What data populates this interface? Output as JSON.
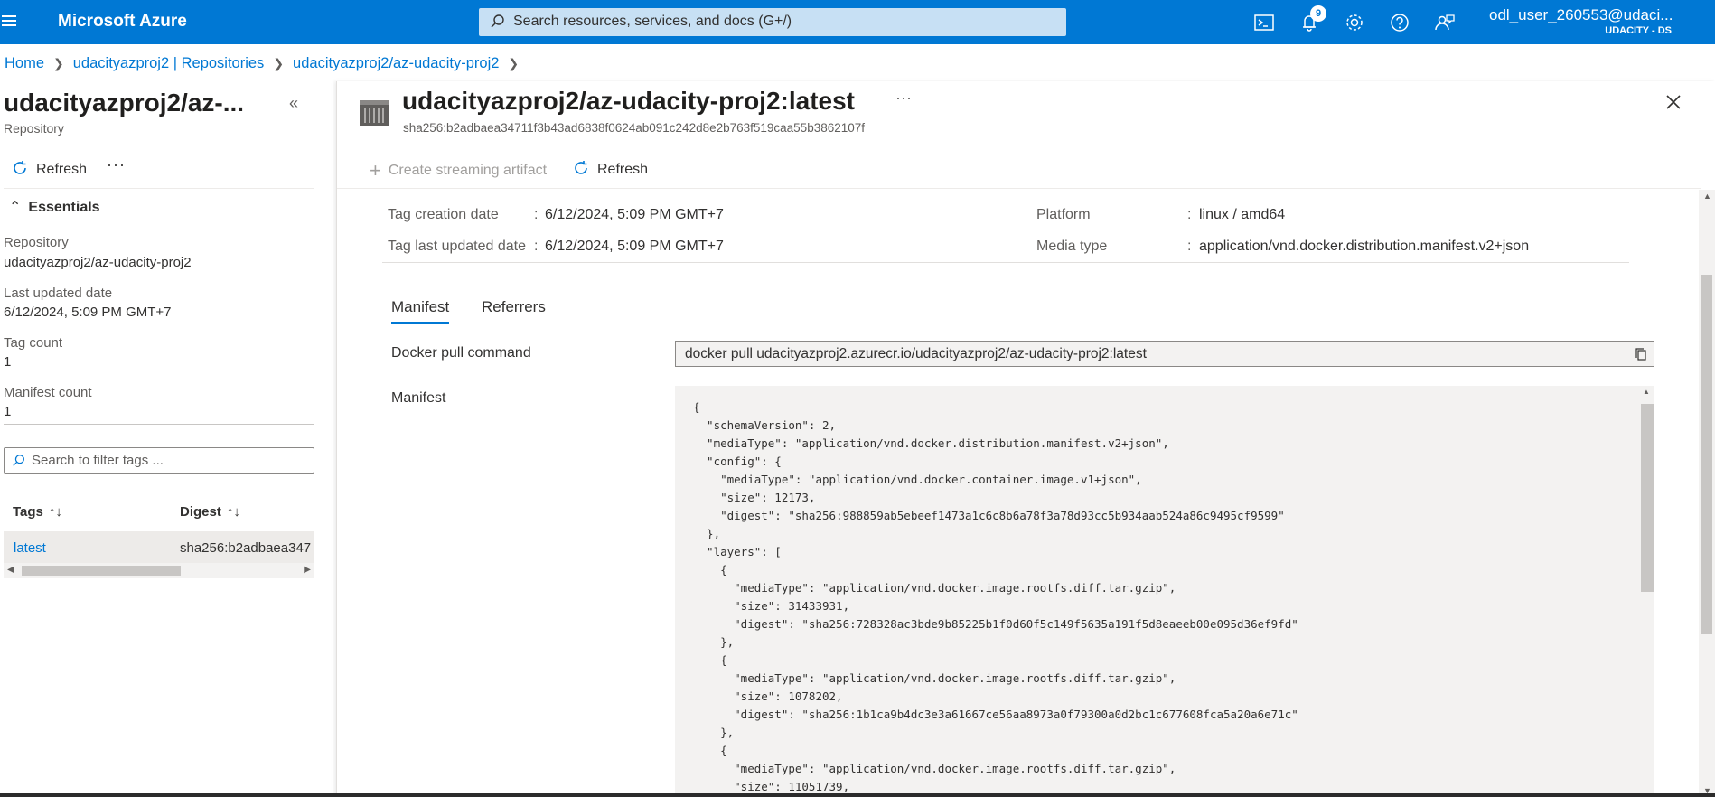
{
  "topbar": {
    "brand": "Microsoft Azure",
    "search_placeholder": "Search resources, services, and docs (G+/)",
    "notification_count": "9",
    "user_name": "odl_user_260553@udaci...",
    "user_tenant": "UDACITY - DS"
  },
  "breadcrumb": {
    "items": [
      "Home",
      "udacityazproj2 | Repositories",
      "udacityazproj2/az-udacity-proj2"
    ]
  },
  "left_pane": {
    "title": "udacityazproj2/az-...",
    "subtitle": "Repository",
    "refresh_label": "Refresh",
    "more_label": "···",
    "essentials_label": "Essentials",
    "properties": [
      {
        "label": "Repository",
        "value": "udacityazproj2/az-udacity-proj2"
      },
      {
        "label": "Last updated date",
        "value": "6/12/2024, 5:09 PM GMT+7"
      },
      {
        "label": "Tag count",
        "value": "1"
      },
      {
        "label": "Manifest count",
        "value": "1"
      }
    ],
    "filter_placeholder": "Search to filter tags ...",
    "table": {
      "headers": [
        "Tags",
        "Digest"
      ],
      "rows": [
        {
          "tag": "latest",
          "digest": "sha256:b2adbaea347"
        }
      ]
    }
  },
  "content": {
    "title": "udacityazproj2/az-udacity-proj2:latest",
    "sha": "sha256:b2adbaea34711f3b43ad6838f0624ab091c242d8e2b763f519caa55b3862107f",
    "more_label": "···",
    "create_artifact_label": "Create streaming artifact",
    "refresh_label": "Refresh",
    "essentials": {
      "tag_creation_label": "Tag creation date",
      "tag_creation_value": "6/12/2024, 5:09 PM GMT+7",
      "tag_updated_label": "Tag last updated date",
      "tag_updated_value": "6/12/2024, 5:09 PM GMT+7",
      "platform_label": "Platform",
      "platform_value": "linux / amd64",
      "media_type_label": "Media type",
      "media_type_value": "application/vnd.docker.distribution.manifest.v2+json",
      "colon": ":"
    },
    "tabs": [
      "Manifest",
      "Referrers"
    ],
    "docker_pull_label": "Docker pull command",
    "docker_pull_value": "docker pull udacityazproj2.azurecr.io/udacityazproj2/az-udacity-proj2:latest",
    "manifest_label": "Manifest",
    "manifest_json": "{\n  \"schemaVersion\": 2,\n  \"mediaType\": \"application/vnd.docker.distribution.manifest.v2+json\",\n  \"config\": {\n    \"mediaType\": \"application/vnd.docker.container.image.v1+json\",\n    \"size\": 12173,\n    \"digest\": \"sha256:988859ab5ebeef1473a1c6c8b6a78f3a78d93cc5b934aab524a86c9495cf9599\"\n  },\n  \"layers\": [\n    {\n      \"mediaType\": \"application/vnd.docker.image.rootfs.diff.tar.gzip\",\n      \"size\": 31433931,\n      \"digest\": \"sha256:728328ac3bde9b85225b1f0d60f5c149f5635a191f5d8eaeeb00e095d36ef9fd\"\n    },\n    {\n      \"mediaType\": \"application/vnd.docker.image.rootfs.diff.tar.gzip\",\n      \"size\": 1078202,\n      \"digest\": \"sha256:1b1ca9b4dc3e3a61667ce56aa8973a0f79300a0d2bc1c677608fca5a20a6e71c\"\n    },\n    {\n      \"mediaType\": \"application/vnd.docker.image.rootfs.diff.tar.gzip\",\n      \"size\": 11051739,"
  },
  "colors": {
    "azure_blue": "#0078d4",
    "search_bg": "#c7e0f4",
    "selected_row": "#edebe9"
  }
}
